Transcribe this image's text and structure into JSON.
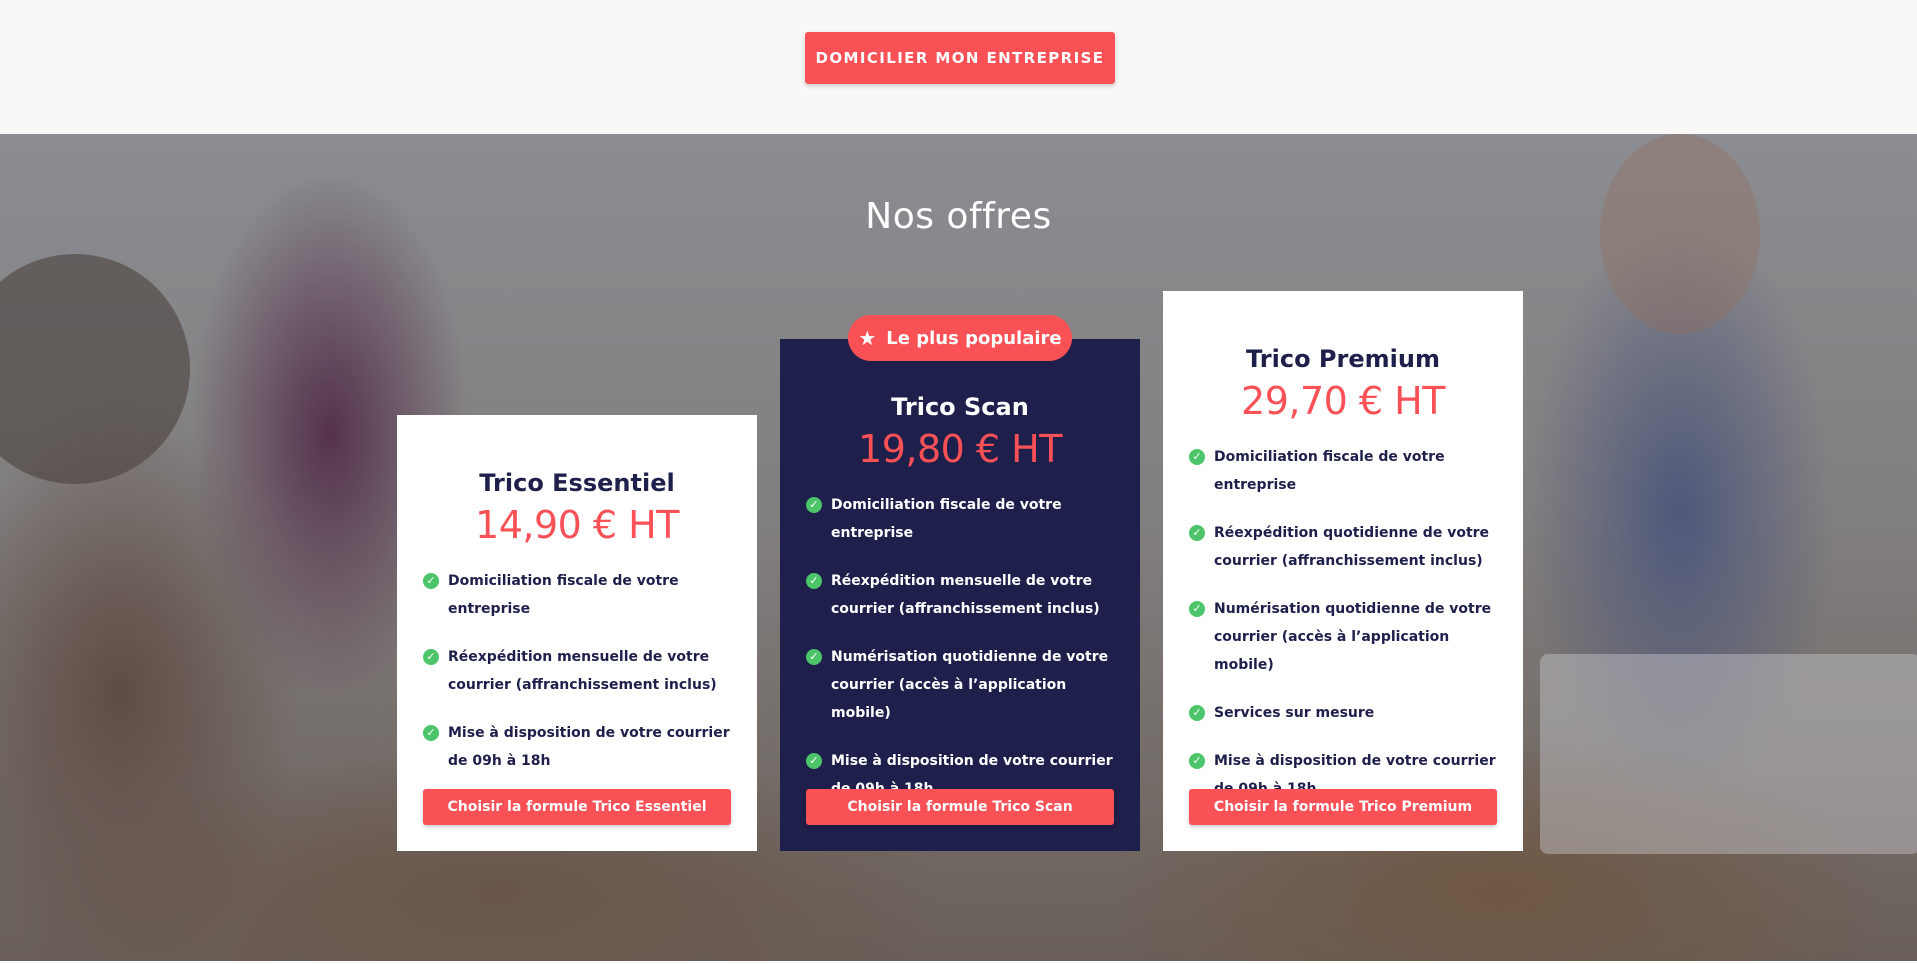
{
  "header": {
    "cta_label": "DOMICILIER MON ENTREPRISE"
  },
  "offers": {
    "title": "Nos offres",
    "popular_badge": "Le plus populaire",
    "popular_icon": "star-icon",
    "plans": [
      {
        "name": "Trico Essentiel",
        "price": "14,90 € HT",
        "features": [
          "Domiciliation fiscale de votre entreprise",
          "Réexpédition mensuelle de votre courrier (affranchissement inclus)",
          "Mise à disposition de votre courrier de 09h à 18h"
        ],
        "button": "Choisir la formule Trico Essentiel"
      },
      {
        "name": "Trico Scan",
        "price": "19,80 € HT",
        "features": [
          "Domiciliation fiscale de votre entreprise",
          "Réexpédition mensuelle de votre courrier (affranchissement inclus)",
          "Numérisation quotidienne de votre courrier (accès à l’application mobile)",
          "Mise à disposition de votre courrier de 09h à 18h"
        ],
        "button": "Choisir la formule Trico Scan"
      },
      {
        "name": "Trico Premium",
        "price": "29,70 € HT",
        "features": [
          "Domiciliation fiscale de votre entreprise",
          "Réexpédition quotidienne de votre courrier (affranchissement inclus)",
          "Numérisation quotidienne de votre courrier (accès à l’application mobile)",
          "Services sur mesure",
          "Mise à disposition de votre courrier de 09h à 18h"
        ],
        "button": "Choisir la formule Trico Premium"
      }
    ]
  },
  "colors": {
    "accent": "#fa5157",
    "navy": "#1e1f4b",
    "check": "#4cc46a",
    "top_band": "#faf8f6"
  }
}
